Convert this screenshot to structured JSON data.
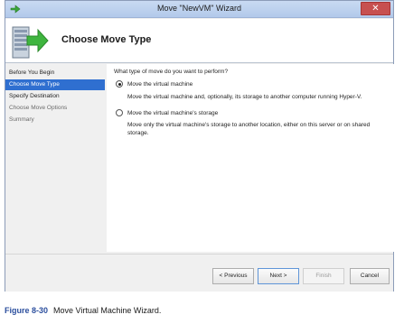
{
  "window": {
    "title": "Move \"NewVM\" Wizard",
    "close_symbol": "✕"
  },
  "header": {
    "title": "Choose Move Type"
  },
  "nav": {
    "items": [
      {
        "label": "Before You Begin",
        "state": "normal"
      },
      {
        "label": "Choose Move Type",
        "state": "selected"
      },
      {
        "label": "Specify Destination",
        "state": "normal"
      },
      {
        "label": "Choose Move Options",
        "state": "disabled"
      },
      {
        "label": "Summary",
        "state": "disabled"
      }
    ]
  },
  "content": {
    "question": "What type of move do you want to perform?",
    "options": [
      {
        "label": "Move the virtual machine",
        "description": "Move the virtual machine and, optionally, its storage to another computer running Hyper-V.",
        "checked": true
      },
      {
        "label": "Move the virtual machine's storage",
        "description": "Move only the virtual machine's storage to another location, either on this server or on shared storage.",
        "checked": false
      }
    ]
  },
  "buttons": {
    "previous": "< Previous",
    "next": "Next >",
    "finish": "Finish",
    "cancel": "Cancel"
  },
  "caption": {
    "figure": "Figure 8-30",
    "text": "Move Virtual Machine Wizard."
  },
  "colors": {
    "selected_nav": "#2f6fd0",
    "close_button": "#c75050",
    "caption_label": "#2c4f9e"
  },
  "icons": {
    "title": "wizard-arrow-icon",
    "header": "server-move-icon"
  }
}
